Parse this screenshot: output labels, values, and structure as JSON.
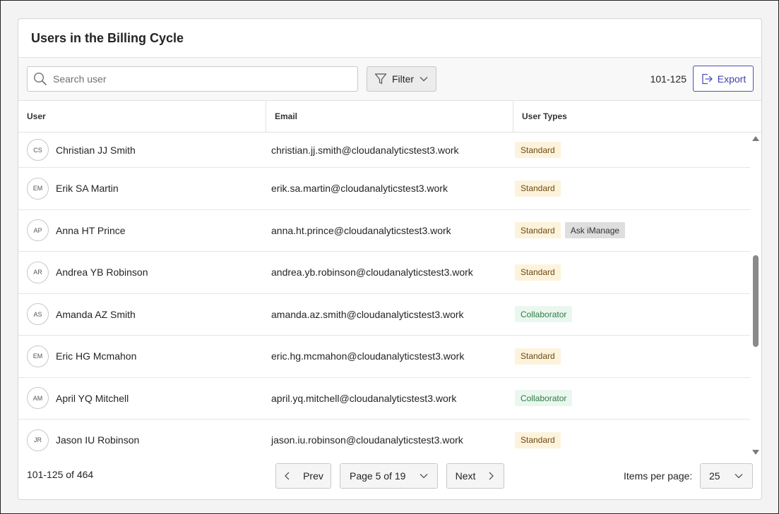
{
  "header": {
    "title": "Users in the Billing Cycle"
  },
  "toolbar": {
    "search_placeholder": "Search user",
    "filter_label": "Filter",
    "range": "101-125",
    "export_label": "Export"
  },
  "table": {
    "columns": [
      "User",
      "Email",
      "User Types"
    ],
    "rows": [
      {
        "initials": "CS",
        "name": "Christian JJ Smith",
        "email": "christian.jj.smith@cloudanalyticstest3.work",
        "types": [
          "Standard"
        ]
      },
      {
        "initials": "EM",
        "name": "Erik SA Martin",
        "email": "erik.sa.martin@cloudanalyticstest3.work",
        "types": [
          "Standard"
        ]
      },
      {
        "initials": "AP",
        "name": "Anna HT Prince",
        "email": "anna.ht.prince@cloudanalyticstest3.work",
        "types": [
          "Standard",
          "Ask iManage"
        ]
      },
      {
        "initials": "AR",
        "name": "Andrea YB Robinson",
        "email": "andrea.yb.robinson@cloudanalyticstest3.work",
        "types": [
          "Standard"
        ]
      },
      {
        "initials": "AS",
        "name": "Amanda AZ Smith",
        "email": "amanda.az.smith@cloudanalyticstest3.work",
        "types": [
          "Collaborator"
        ]
      },
      {
        "initials": "EM",
        "name": "Eric HG Mcmahon",
        "email": "eric.hg.mcmahon@cloudanalyticstest3.work",
        "types": [
          "Standard"
        ]
      },
      {
        "initials": "AM",
        "name": "April YQ Mitchell",
        "email": "april.yq.mitchell@cloudanalyticstest3.work",
        "types": [
          "Collaborator"
        ]
      },
      {
        "initials": "JR",
        "name": "Jason IU Robinson",
        "email": "jason.iu.robinson@cloudanalyticstest3.work",
        "types": [
          "Standard"
        ]
      }
    ]
  },
  "footer": {
    "range_text": "101-125 of 464",
    "prev_label": "Prev",
    "page_select_value": "Page 5 of 19",
    "next_label": "Next",
    "items_per_page_label": "Items per page:",
    "items_per_page_value": "25"
  },
  "colors": {
    "accent": "#4d4fc0",
    "standard_badge_bg": "#fdf3dc",
    "collaborator_badge_bg": "#eaf7ef",
    "ask_badge_bg": "#dedede"
  },
  "icons": {
    "search": "search-icon",
    "filter": "filter-icon",
    "export": "export-icon",
    "chevron_down": "chevron-down-icon",
    "chevron_left": "chevron-left-icon",
    "chevron_right": "chevron-right-icon"
  }
}
